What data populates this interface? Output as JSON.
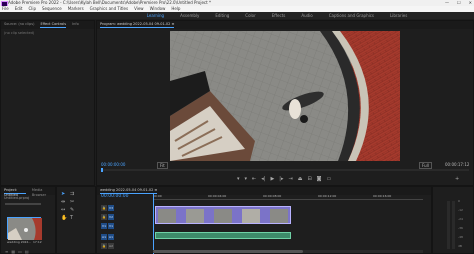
{
  "app": {
    "title": "Adobe Premiere Pro 2022 - C:\\Users\\Kylah Bell\\Documents\\Adobe\\Premiere Pro\\22.0\\Untitled Project *",
    "window_controls": [
      "—",
      "☐",
      "✕"
    ]
  },
  "menu": [
    "File",
    "Edit",
    "Clip",
    "Sequence",
    "Markers",
    "Graphics and Titles",
    "View",
    "Window",
    "Help"
  ],
  "workspaces": {
    "items": [
      "Learning",
      "Assembly",
      "Editing",
      "Color",
      "Effects",
      "Audio",
      "Captions and Graphics",
      "Libraries"
    ],
    "active_index": 0
  },
  "source_panel": {
    "tabs": [
      "Source: (no clips)",
      "Effect Controls",
      "Info"
    ],
    "active_tab": 1,
    "subheader": "(no clip selected)"
  },
  "program_panel": {
    "tab": "Program: wedding 2022-05-04 09-01-02 ≡",
    "current_time": "00:00:00:00",
    "fit": "Fit",
    "duration": "00:00:17:12",
    "quality": "Full",
    "transport_icons": [
      "mark-in-icon",
      "mark-out-icon",
      "go-to-in-icon",
      "step-back-icon",
      "play-icon",
      "step-forward-icon",
      "go-to-out-icon",
      "lift-icon",
      "extract-icon",
      "export-frame-icon",
      "compare-icon"
    ]
  },
  "project_panel": {
    "tabs": [
      "Project: Untitled",
      "Media Browser"
    ],
    "items_label": "Untitled.prproj",
    "clip_name": "wedding 2022...",
    "clip_duration": "17:12"
  },
  "timeline": {
    "tab": "wedding 2022-05-04 09-01-02 ≡",
    "timecode": "00:00:00:00",
    "ruler": [
      "00:00",
      "00:00:04:00",
      "00:00:08:00",
      "00:00:12:00",
      "00:00:16:00"
    ],
    "tracks": [
      {
        "label": "V3"
      },
      {
        "label": "V2"
      },
      {
        "label": "V1"
      },
      {
        "label": "A1"
      },
      {
        "label": "A2"
      },
      {
        "label": "A3"
      }
    ]
  },
  "meters": {
    "scale": [
      "0",
      "-12",
      "-24",
      "-36",
      "-48",
      "dB"
    ]
  },
  "colors": {
    "accent": "#4aa3ff",
    "clip_video": "#7b73c8",
    "clip_audio": "#3d8a6a",
    "brick": "#b13a2c"
  }
}
